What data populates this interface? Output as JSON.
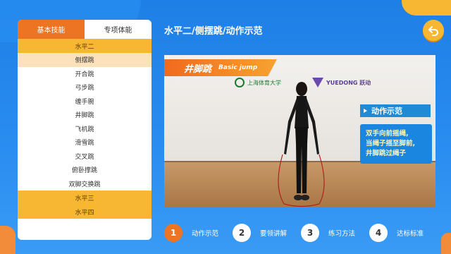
{
  "sidebar": {
    "tabs": [
      {
        "label": "基本技能",
        "active": true
      },
      {
        "label": "专项体能",
        "active": false
      }
    ],
    "group_level2": "水平二",
    "items": [
      "侧摆跳",
      "开合跳",
      "弓步跳",
      "缠手腕",
      "井脚跳",
      "飞机跳",
      "滑雪跳",
      "交叉跳",
      "俯卧撑跳",
      "双脚交换跳"
    ],
    "selected_index": 0,
    "group_level3": "水平三",
    "group_level4": "水平四"
  },
  "header": {
    "title": "水平二/侧摆跳/动作示范",
    "back_icon": "back-arrow-icon"
  },
  "video": {
    "banner_cn": "井脚跳",
    "banner_en": "Basic jump",
    "logo_left": "上海体育大学",
    "logo_right": "YUEDONG 跃动",
    "tag": "动作示范",
    "caption_lines": [
      "双手向前摇绳,",
      "当绳子摇至脚前,",
      "井脚跳过绳子"
    ]
  },
  "steps": [
    {
      "num": "1",
      "label": "动作示范",
      "active": true
    },
    {
      "num": "2",
      "label": "要领讲解",
      "active": false
    },
    {
      "num": "3",
      "label": "练习方法",
      "active": false
    },
    {
      "num": "4",
      "label": "达标标准",
      "active": false
    }
  ],
  "colors": {
    "accent": "#ec7422",
    "group": "#f7b733",
    "selected": "#fbe2ba",
    "background": "#2a8df0"
  }
}
